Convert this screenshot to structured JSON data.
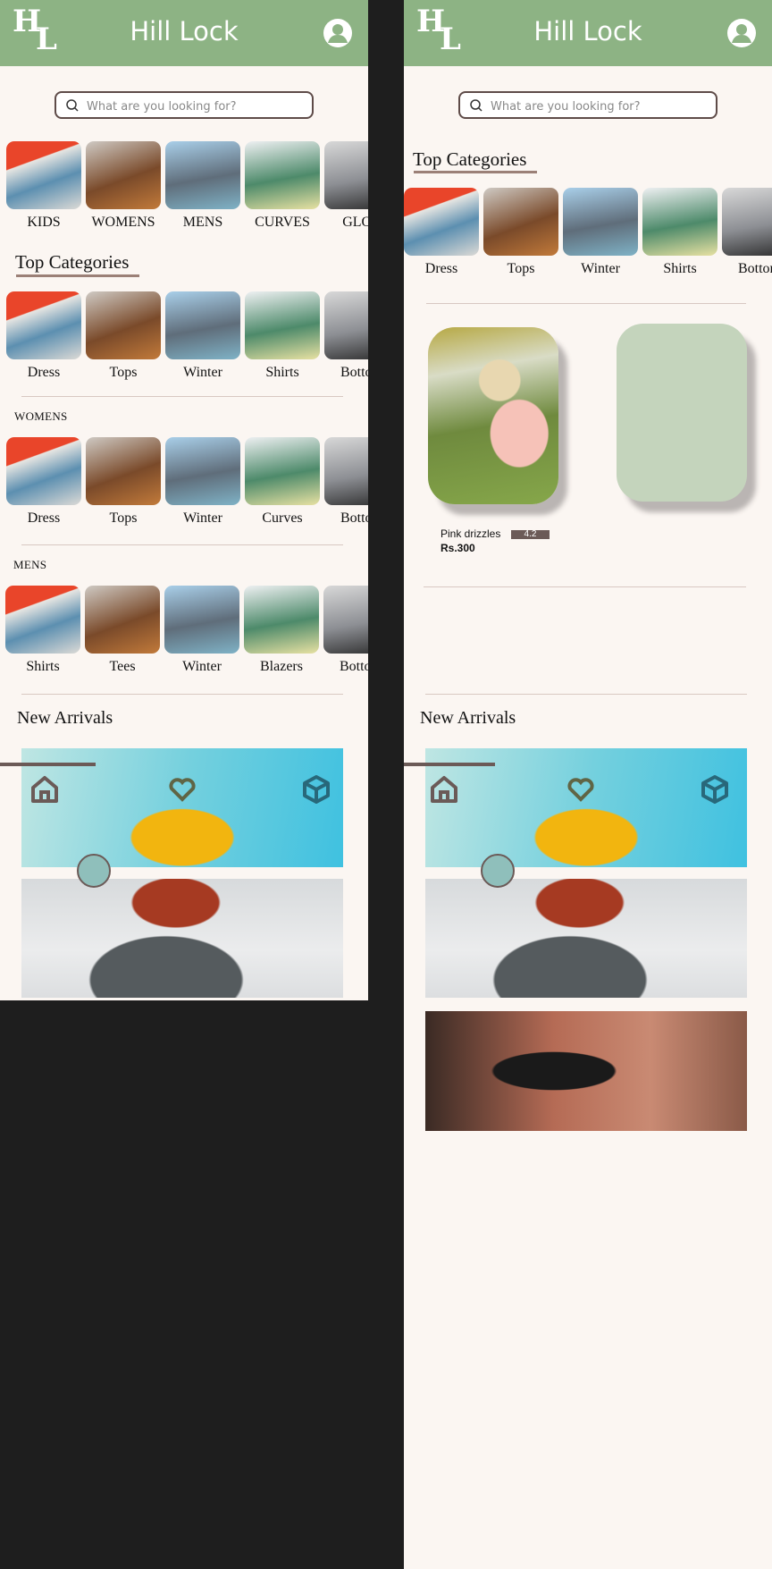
{
  "app": {
    "title": "Hill Lock",
    "logo_text": "HL"
  },
  "colors": {
    "header": "#8db384",
    "background": "#fbf6f2",
    "accent": "#6b5a57",
    "card_placeholder": "#c4d4bc"
  },
  "search": {
    "placeholder": "What are you looking for?"
  },
  "shop_categories": [
    {
      "label": "KIDS"
    },
    {
      "label": "WOMENS"
    },
    {
      "label": "MENS"
    },
    {
      "label": "CURVES"
    },
    {
      "label": "GLOB"
    }
  ],
  "top_categories": {
    "title": "Top Categories",
    "items": [
      {
        "label": "Dress"
      },
      {
        "label": "Tops"
      },
      {
        "label": "Winter"
      },
      {
        "label": "Shirts"
      },
      {
        "label": "Bottom"
      }
    ]
  },
  "womens": {
    "title": "WOMENS",
    "items": [
      {
        "label": "Dress"
      },
      {
        "label": "Tops"
      },
      {
        "label": "Winter"
      },
      {
        "label": "Curves"
      },
      {
        "label": "Bottom"
      }
    ]
  },
  "mens": {
    "title": "MENS",
    "items": [
      {
        "label": "Shirts"
      },
      {
        "label": "Tees"
      },
      {
        "label": "Winter"
      },
      {
        "label": "Blazers"
      },
      {
        "label": "Bottom"
      }
    ]
  },
  "new_arrivals": {
    "title": "New Arrivals"
  },
  "product": {
    "name": "Pink drizzles",
    "rating": "4.2",
    "price": "Rs.300"
  },
  "bottom_nav": {
    "icons": [
      "home-icon",
      "heart-icon",
      "cube-icon"
    ]
  }
}
